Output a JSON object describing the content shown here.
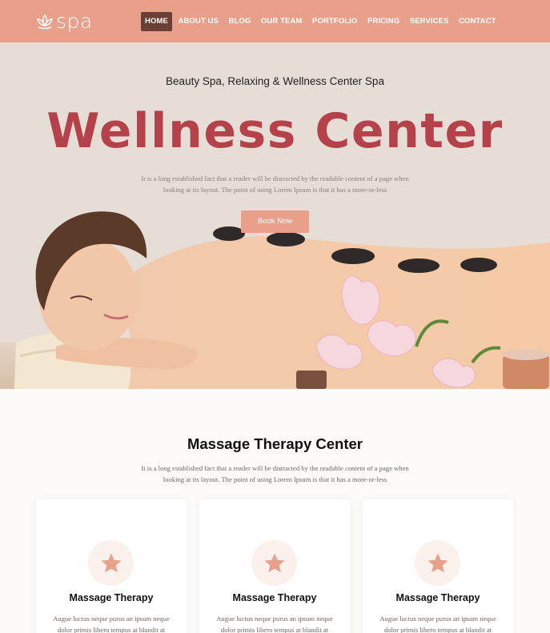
{
  "brand": {
    "logo_text": "spa"
  },
  "nav": {
    "items": [
      {
        "label": "HOME",
        "active": true
      },
      {
        "label": "ABOUT US",
        "active": false
      },
      {
        "label": "BLOG",
        "active": false
      },
      {
        "label": "OUR TEAM",
        "active": false
      },
      {
        "label": "PORTFOLIO",
        "active": false
      },
      {
        "label": "PRICING",
        "active": false
      },
      {
        "label": "SERVICES",
        "active": false
      },
      {
        "label": "CONTACT",
        "active": false
      }
    ]
  },
  "hero": {
    "kicker": "Beauty Spa, Relaxing & Wellness Center Spa",
    "title": "Wellness Center",
    "text": "It is a long established fact that a reader will be distracted by the readable content of a page when looking at its layout. The point of using Lorem Ipsum is that it has a more-or-less",
    "button_label": "Book Now",
    "image_icon": "spa-massage-photo"
  },
  "services": {
    "title": "Massage Therapy Center",
    "text": "It is a long established fact that a reader will be distracted by the readable content of a page when looking at its layout. The point of using Lorem Ipsum is that it has a more-or-less",
    "cards": [
      {
        "icon": "star-icon",
        "title": "Massage Therapy",
        "text": "Augue luctus neque purus an ipsum neque dolor primis libero tempus at blandit at"
      },
      {
        "icon": "star-icon",
        "title": "Massage Therapy",
        "text": "Augue luctus neque purus an ipsum neque dolor primis libero tempus at blandit at"
      },
      {
        "icon": "star-icon",
        "title": "Massage Therapy",
        "text": "Augue luctus neque purus an ipsum neque dolor primis libero tempus at blandit at"
      }
    ]
  },
  "colors": {
    "accent": "#e8a08a",
    "nav_active": "#6b3f33",
    "title_red": "#b5414a",
    "hero_bg": "#e6ddd7",
    "icon_circle": "#faf0ec"
  }
}
